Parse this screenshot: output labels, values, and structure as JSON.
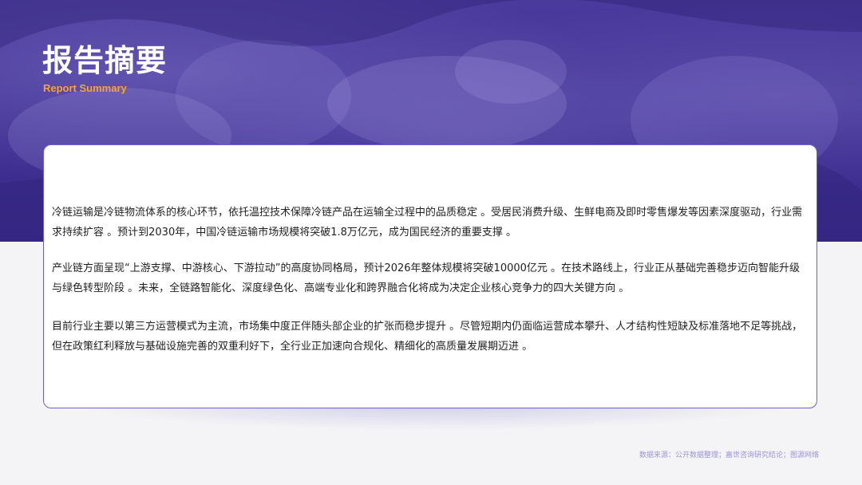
{
  "header": {
    "title": "报告摘要",
    "subtitle": "Report Summary"
  },
  "summary": {
    "paragraphs": [
      "冷链运输是冷链物流体系的核心环节，依托温控技术保障冷链产品在运输全过程中的品质稳定 。受居民消费升级、生鲜电商及即时零售爆发等因素深度驱动，行业需求持续扩容 。预计到2030年，中国冷链运输市场规模将突破1.8万亿元，成为国民经济的重要支撑 。",
      "产业链方面呈现“上游支撑、中游核心、下游拉动”的高度协同格局，预计2026年整体规模将突破10000亿元 。在技术路线上，行业正从基础完善稳步迈向智能升级与绿色转型阶段 。未来，全链路智能化、深度绿色化、高端专业化和跨界融合化将成为决定企业核心竞争力的四大关键方向 。",
      "目前行业主要以第三方运营模式为主流，市场集中度正伴随头部企业的扩张而稳步提升 。尽管短期内仍面临运营成本攀升、人才结构性短缺及标准落地不足等挑战，但在政策红利释放与基础设施完善的双重利好下，全行业正加速向合规化、精细化的高质量发展期迈进 。"
    ]
  },
  "footer": {
    "source": "数据来源：公开数据整理；嘉世咨询研究结论；图源网络"
  },
  "colors": {
    "hero": "#3f2f92",
    "accent": "#f3a33a",
    "card_border": "#6b5fd6",
    "source_text": "#9b94d8"
  }
}
